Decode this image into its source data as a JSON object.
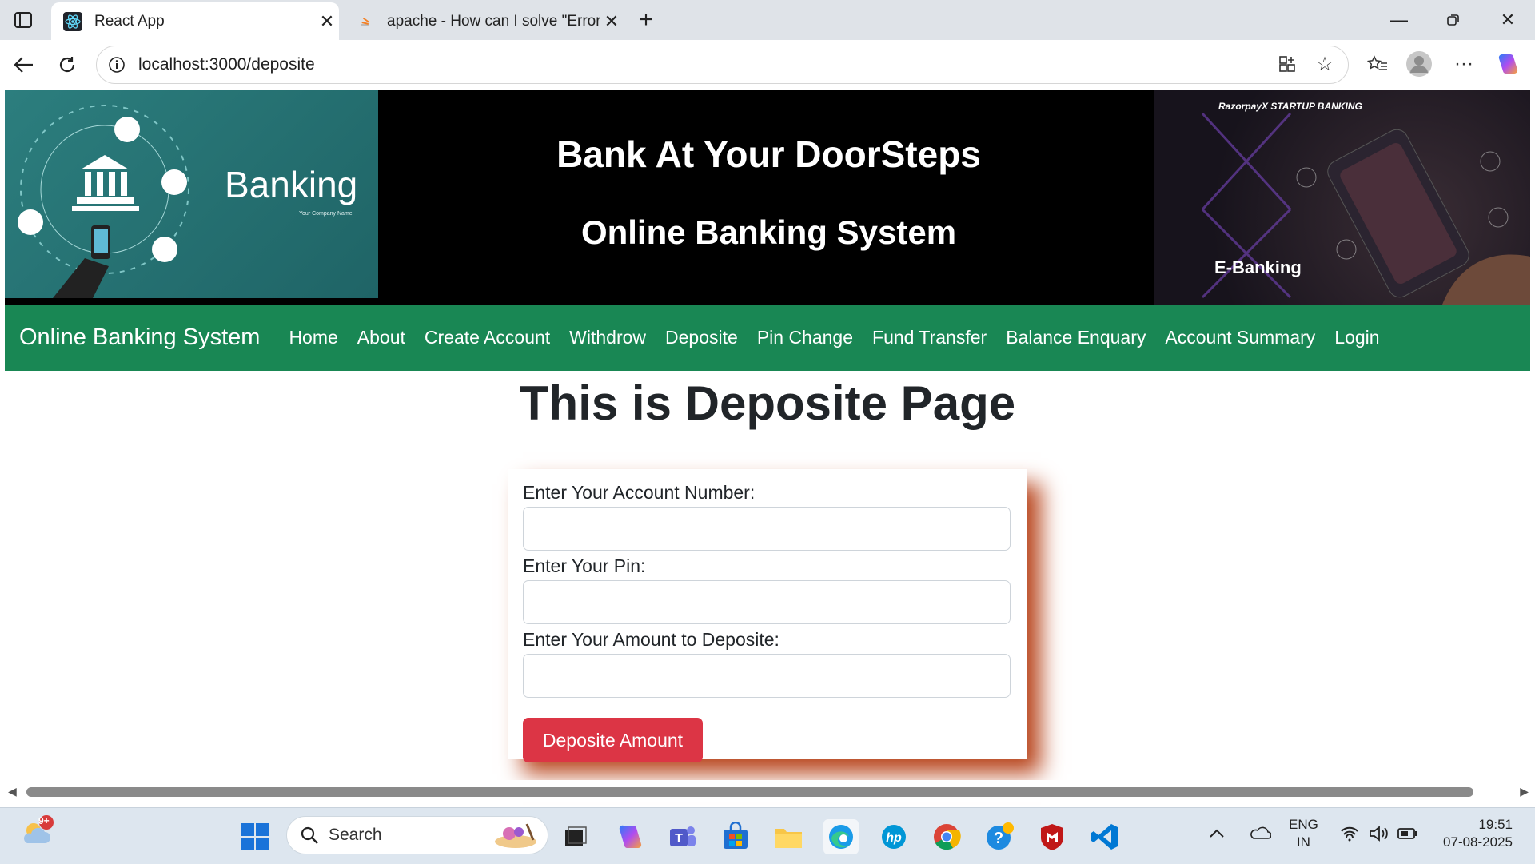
{
  "browser": {
    "tabs": [
      {
        "title": "React App",
        "active": true
      },
      {
        "title": "apache - How can I solve \"Error: M",
        "active": false
      }
    ],
    "url": "localhost:3000/deposite"
  },
  "banner": {
    "logo_word": "Banking",
    "logo_sub": "Your Company Name",
    "heading": "Bank At Your DoorSteps",
    "subheading": "Online Banking System",
    "ebank_brand": "RazorpayX STARTUP BANKING",
    "ebank_label": "E-Banking"
  },
  "navbar": {
    "brand": "Online Banking System",
    "links": [
      "Home",
      "About",
      "Create Account",
      "Withdrow",
      "Deposite",
      "Pin Change",
      "Fund Transfer",
      "Balance Enquary",
      "Account Summary",
      "Login"
    ]
  },
  "page_title": "This is Deposite Page",
  "form": {
    "account_label": "Enter Your Account Number:",
    "pin_label": "Enter Your Pin:",
    "amount_label": "Enter Your Amount to Deposite:",
    "submit_label": "Deposite Amount"
  },
  "taskbar": {
    "notification_badge": "9+",
    "search_label": "Search",
    "lang_top": "ENG",
    "lang_bottom": "IN",
    "time": "19:51",
    "date": "07-08-2025"
  },
  "colors": {
    "navbar": "#198754",
    "button": "#dc3545",
    "card_shadow": "#b9471f"
  }
}
